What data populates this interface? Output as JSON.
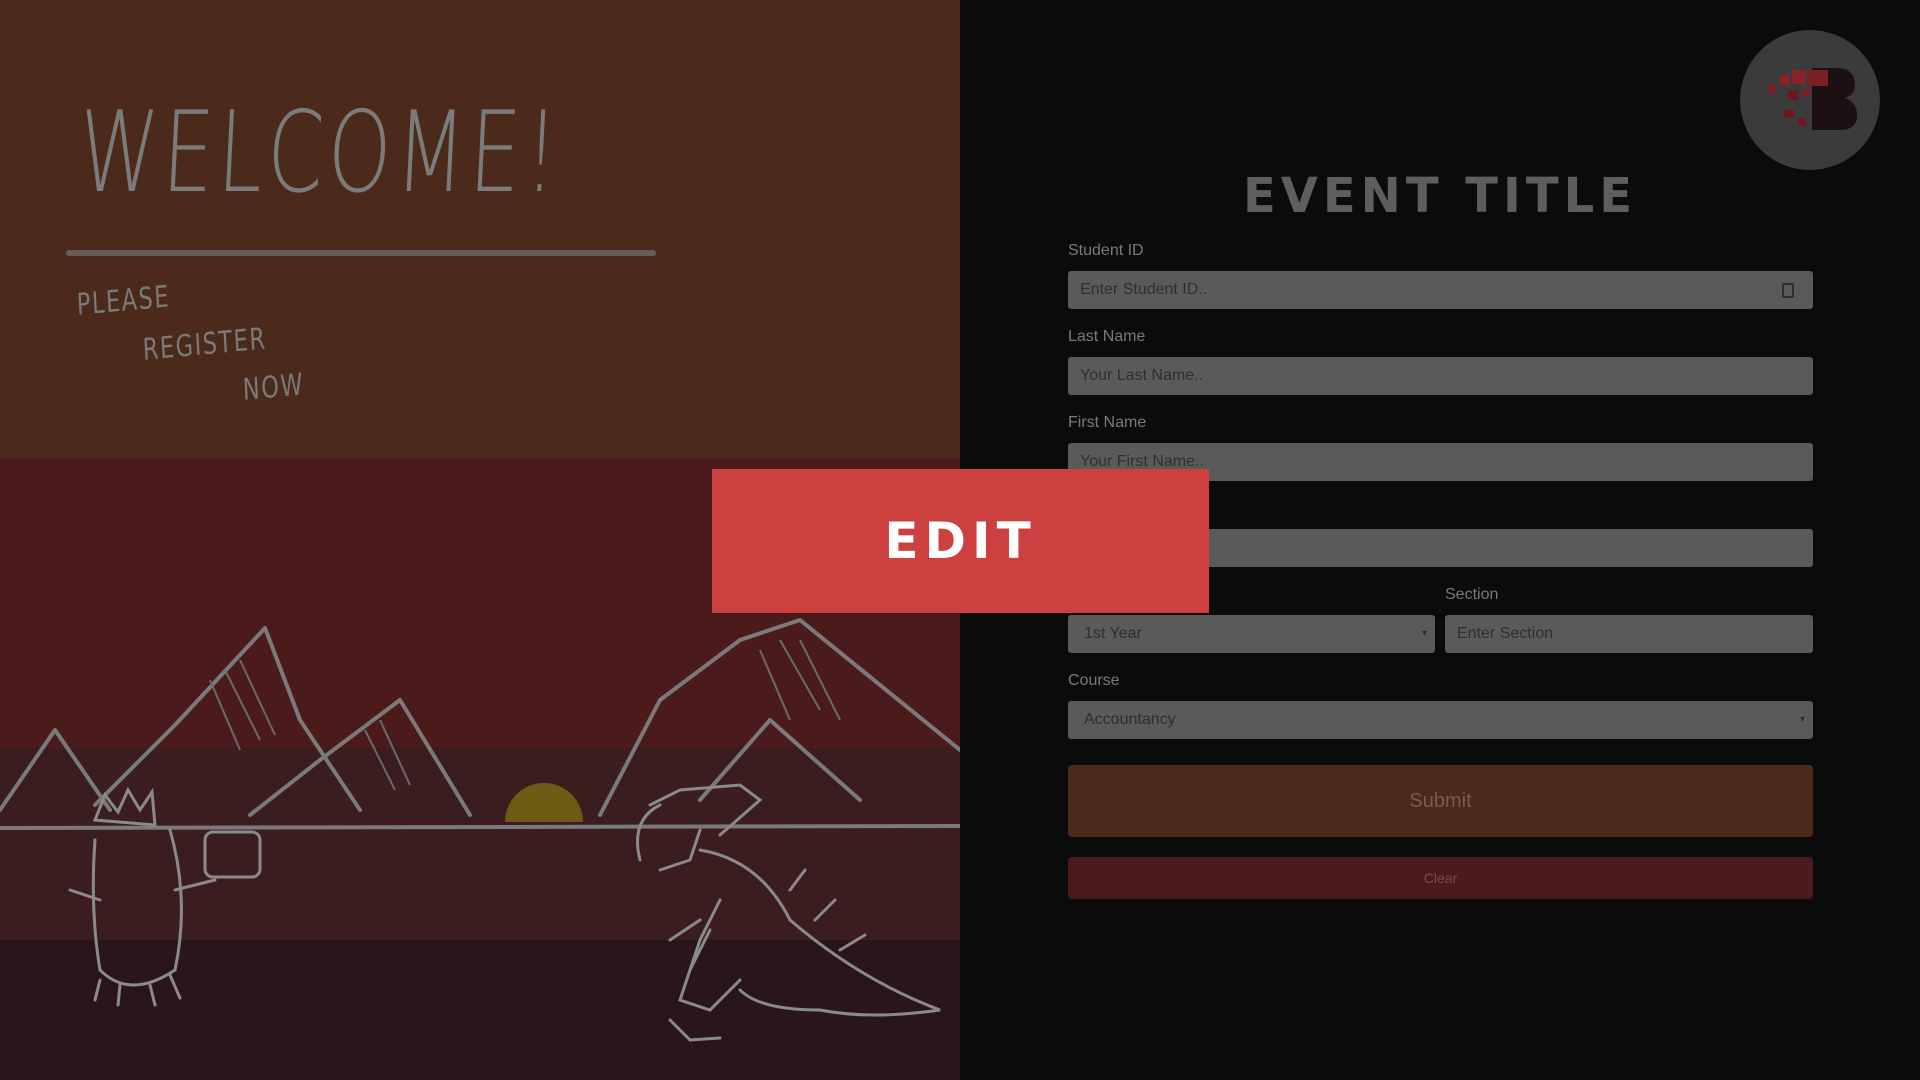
{
  "art": {
    "welcome_text": "WELCOME!",
    "handwriting": [
      "PLEASE",
      "REGISTER",
      "NOW"
    ]
  },
  "form": {
    "title": "EVENT TITLE",
    "logo_icon": "b-pixel-logo-icon",
    "student_id": {
      "label": "Student ID",
      "placeholder": "Enter Student ID.."
    },
    "last_name": {
      "label": "Last Name",
      "placeholder": "Your Last Name.."
    },
    "first_name": {
      "label": "First Name",
      "placeholder": "Your First Name.."
    },
    "hidden_field": {
      "placeholder": "..."
    },
    "section": {
      "label": "Section",
      "placeholder": "Enter Section"
    },
    "year": {
      "selected": "1st Year"
    },
    "course": {
      "label": "Course",
      "selected": "Accountancy"
    },
    "submit_label": "Submit",
    "clear_label": "Clear"
  },
  "overlay": {
    "label": "EDIT"
  },
  "colors": {
    "accent_overlay": "#cd4040",
    "submit_bg": "#4b2a1c",
    "clear_bg": "#4b1b1c",
    "sun": "#6e5a12"
  }
}
